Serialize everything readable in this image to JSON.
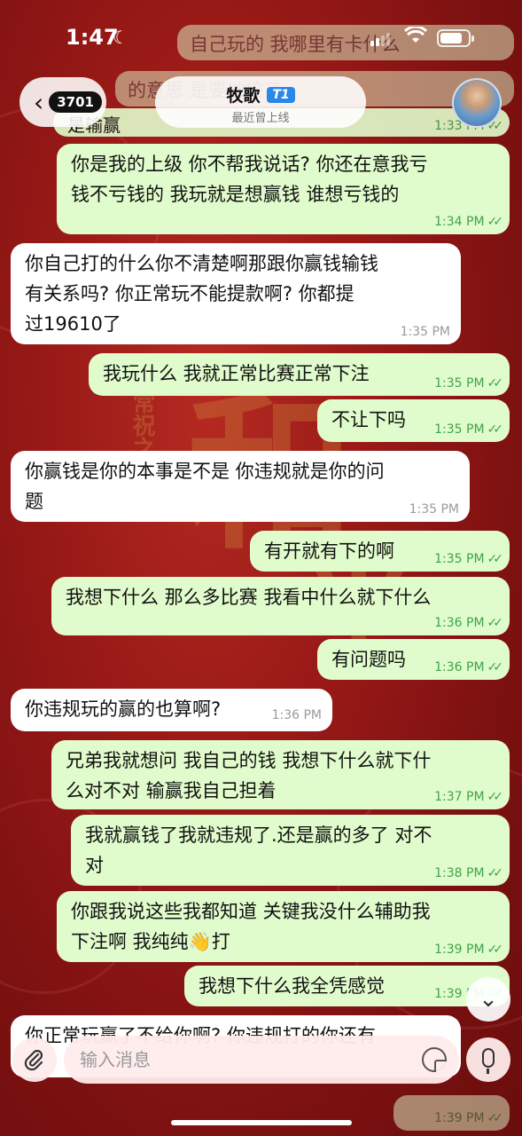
{
  "status_bar": {
    "time": "1:47"
  },
  "header": {
    "back_count": "3701",
    "contact_name": "牧歌",
    "contact_badge": "T1",
    "contact_status": "最近曾上线"
  },
  "messages_partial_top": [
    {
      "text": "自己玩的 我哪里有卡什么",
      "dir": "out"
    },
    {
      "text": "的意思 是要被控了",
      "dir": "out"
    },
    {
      "text": "是输赢",
      "dir": "in"
    }
  ],
  "messages": [
    {
      "dir": "out",
      "lines": [
        "你是我的上级 你不帮我说话? 你还在意我亏",
        "钱不亏钱的 我玩就是想赢钱 谁想亏钱的"
      ],
      "time": "1:34 PM"
    },
    {
      "dir": "in",
      "lines": [
        "你自己打的什么你不清楚啊那跟你赢钱输钱",
        "有关系吗? 你正常玩不能提款啊?   你都提",
        "过19610了"
      ],
      "time": "1:35 PM"
    },
    {
      "dir": "out",
      "lines": [
        "我玩什么 我就正常比赛正常下注"
      ],
      "time": "1:35 PM"
    },
    {
      "dir": "out",
      "lines": [
        "不让下吗"
      ],
      "time": "1:35 PM"
    },
    {
      "dir": "in",
      "lines": [
        "你赢钱是你的本事是不是 你违规就是你的问",
        "题"
      ],
      "time": "1:35 PM"
    },
    {
      "dir": "out",
      "lines": [
        "有开就有下的啊"
      ],
      "time": "1:35 PM"
    },
    {
      "dir": "out",
      "lines": [
        "我想下什么 那么多比赛 我看中什么就下什么"
      ],
      "time": "1:36 PM"
    },
    {
      "dir": "out",
      "lines": [
        "有问题吗"
      ],
      "time": "1:36 PM"
    },
    {
      "dir": "in",
      "lines": [
        "你违规玩的赢的也算啊?"
      ],
      "time": "1:36 PM"
    },
    {
      "dir": "out",
      "lines": [
        "兄弟我就想问 我自己的钱 我想下什么就下什",
        "么对不对 输赢我自己担着"
      ],
      "time": "1:37 PM"
    },
    {
      "dir": "out",
      "lines": [
        "我就赢钱了我就违规了.还是赢的多了 对不",
        "对"
      ],
      "time": "1:38 PM"
    },
    {
      "dir": "out",
      "lines": [
        "你跟我说这些我都知道 关键我没什么辅助我",
        "下注啊 我纯纯👋打"
      ],
      "time": "1:39 PM"
    },
    {
      "dir": "out",
      "lines": [
        "我想下什么我全凭感觉"
      ],
      "time": "1:39 PM"
    },
    {
      "dir": "in",
      "lines": [
        "你正常玩赢了不给你啊? 你违规打的你还有"
      ],
      "time": ""
    }
  ],
  "top_partial_time": "1:33 PM",
  "bottom_partial_time": "1:39 PM",
  "input": {
    "placeholder": "输入消息"
  },
  "icons": {
    "back": "chevron-left-icon",
    "attach": "paperclip-icon",
    "sticker": "sticker-icon",
    "mic": "microphone-icon",
    "scroll": "chevron-down-icon"
  },
  "colors": {
    "outgoing_bubble": "#e1fccc",
    "incoming_bubble": "#ffffff",
    "timestamp_out": "#3ea34a",
    "background": "#8f1414"
  }
}
